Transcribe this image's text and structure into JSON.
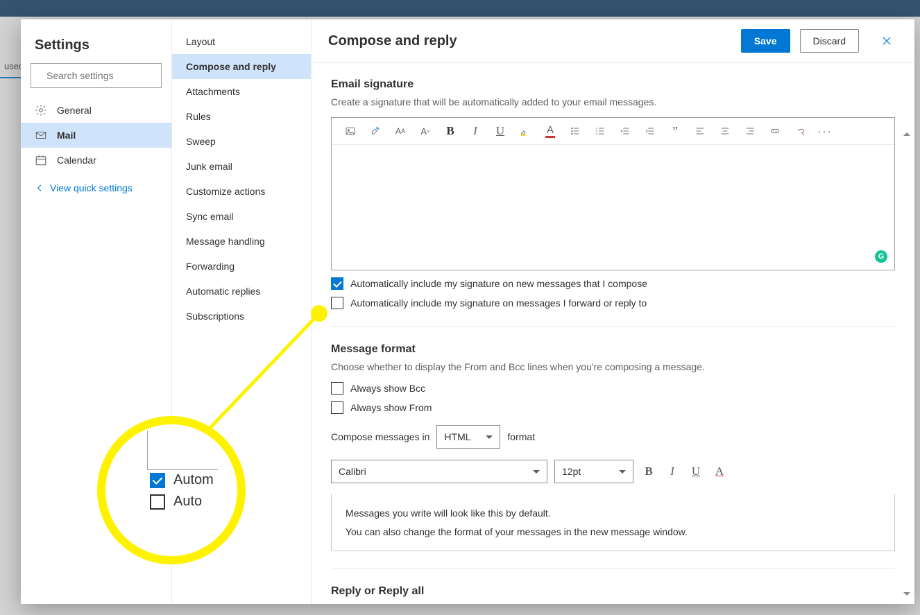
{
  "bg_tab": "used",
  "leftcol": {
    "title": "Settings",
    "search_placeholder": "Search settings",
    "categories": [
      {
        "label": "General"
      },
      {
        "label": "Mail"
      },
      {
        "label": "Calendar"
      }
    ],
    "quick_link": "View quick settings"
  },
  "midcol": {
    "items": [
      "Layout",
      "Compose and reply",
      "Attachments",
      "Rules",
      "Sweep",
      "Junk email",
      "Customize actions",
      "Sync email",
      "Message handling",
      "Forwarding",
      "Automatic replies",
      "Subscriptions"
    ],
    "active_index": 1
  },
  "header": {
    "title": "Compose and reply",
    "save": "Save",
    "discard": "Discard"
  },
  "signature": {
    "heading": "Email signature",
    "sub": "Create a signature that will be automatically added to your email messages.",
    "chk_new": "Automatically include my signature on new messages that I compose",
    "chk_new_checked": true,
    "chk_fwd": "Automatically include my signature on messages I forward or reply to",
    "chk_fwd_checked": false
  },
  "format": {
    "heading": "Message format",
    "sub": "Choose whether to display the From and Bcc lines when you're composing a message.",
    "chk_bcc": "Always show Bcc",
    "chk_from": "Always show From",
    "compose_in_pre": "Compose messages in",
    "compose_in_sel": "HTML",
    "compose_in_post": "format",
    "font": "Calibri",
    "size": "12pt",
    "preview1": "Messages you write will look like this by default.",
    "preview2": "You can also change the format of your messages in the new message window."
  },
  "reply": {
    "heading": "Reply or Reply all"
  },
  "zoom": {
    "l1": "Autom",
    "l2": "Auto"
  }
}
